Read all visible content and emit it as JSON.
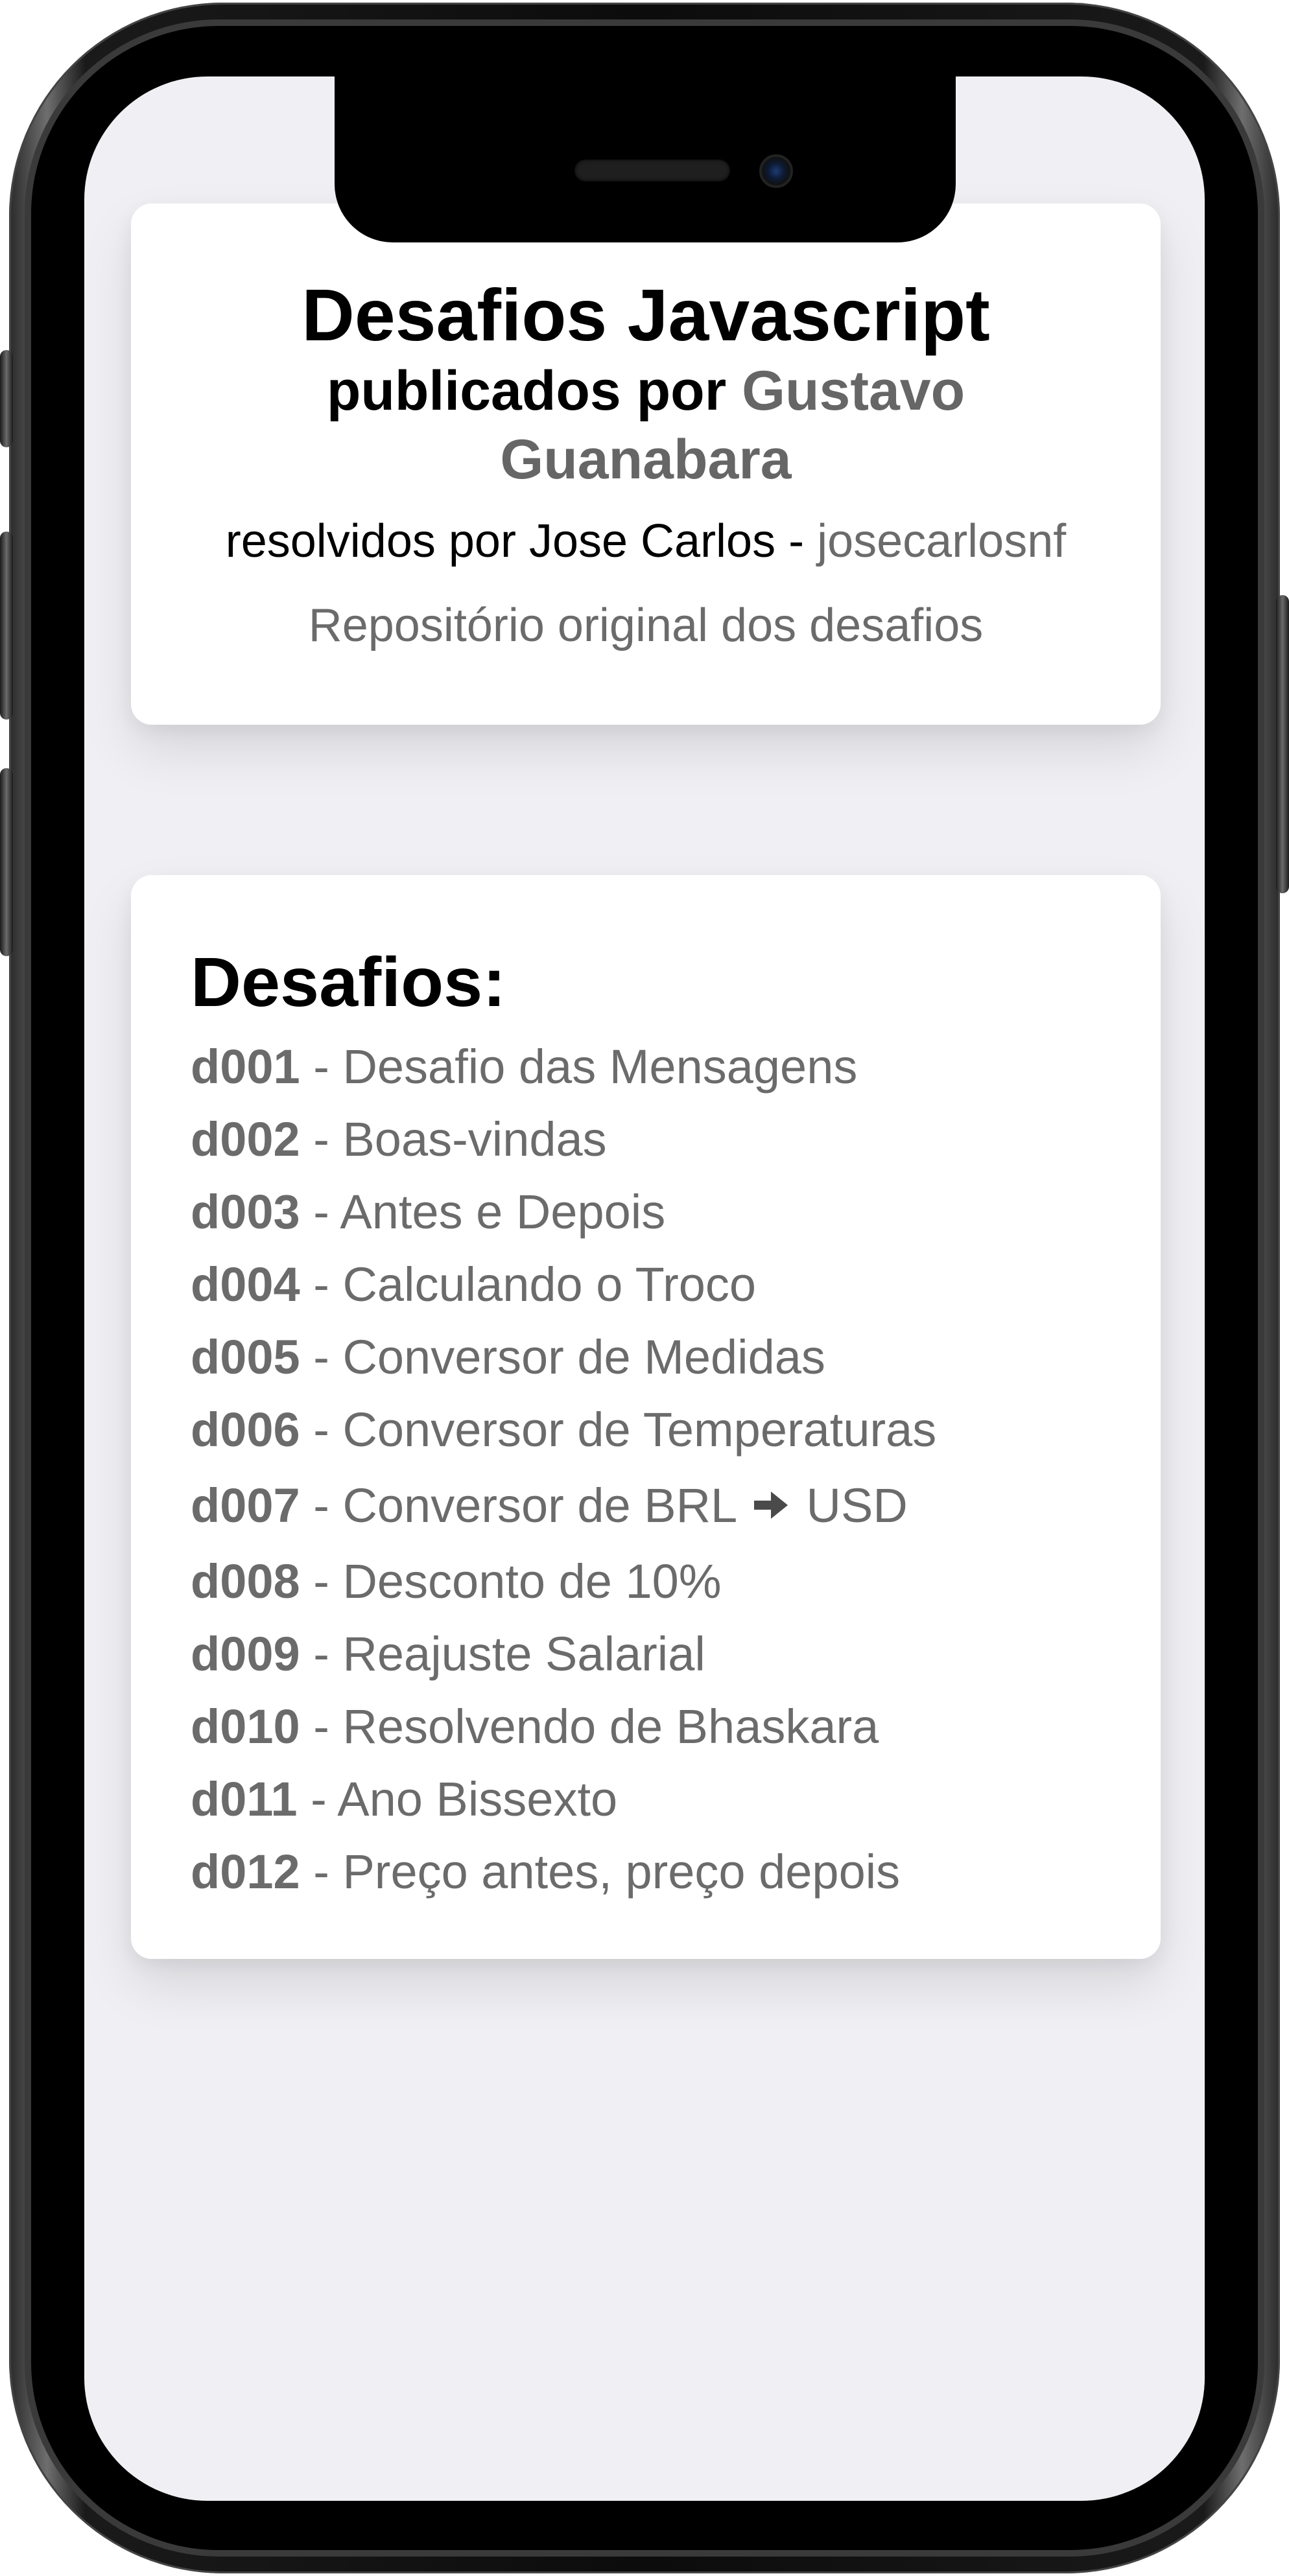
{
  "header": {
    "title": "Desafios Javascript",
    "subtitle_prefix": "publicados por ",
    "author_link": "Gustavo Guanabara",
    "solver_prefix": "resolvidos por Jose Carlos - ",
    "solver_handle": "josecarlosnf",
    "repo_link": "Repositório original dos desafios"
  },
  "challenges": {
    "title": "Desafios:",
    "separator": " - ",
    "items": [
      {
        "code": "d001",
        "name": "Desafio das Mensagens"
      },
      {
        "code": "d002",
        "name": "Boas-vindas"
      },
      {
        "code": "d003",
        "name": "Antes e Depois"
      },
      {
        "code": "d004",
        "name": "Calculando o Troco"
      },
      {
        "code": "d005",
        "name": "Conversor de Medidas"
      },
      {
        "code": "d006",
        "name": "Conversor de Temperaturas"
      },
      {
        "code": "d007",
        "name_before": "Conversor de BRL",
        "icon": "arrow-right-icon",
        "name_after": "USD"
      },
      {
        "code": "d008",
        "name": "Desconto de 10%"
      },
      {
        "code": "d009",
        "name": "Reajuste Salarial"
      },
      {
        "code": "d010",
        "name": "Resolvendo de Bhaskara"
      },
      {
        "code": "d011",
        "name": "Ano Bissexto"
      },
      {
        "code": "d012",
        "name": "Preço antes, preço depois"
      }
    ]
  },
  "colors": {
    "screen_background": "#f0f0f4",
    "card_background": "#ffffff",
    "text_primary": "#000000",
    "text_muted": "#6b6b6b"
  }
}
